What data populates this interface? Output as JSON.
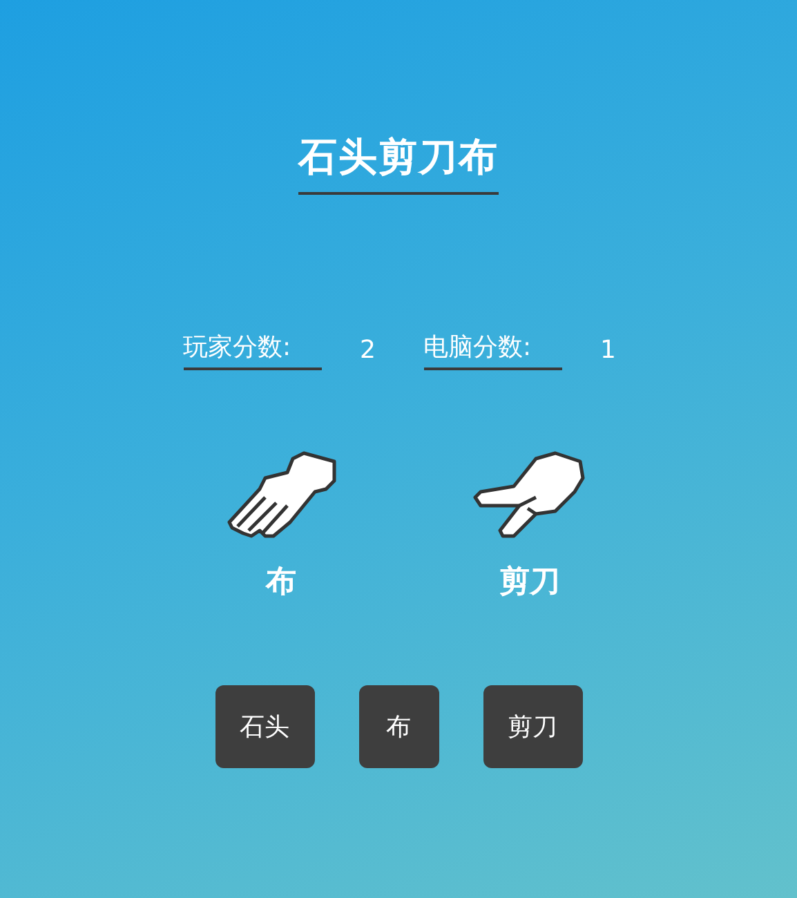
{
  "title": "石头剪刀布",
  "scores": [
    {
      "label": "玩家分数:",
      "value": "2"
    },
    {
      "label": "电脑分数:",
      "value": "1"
    }
  ],
  "choices": [
    {
      "kind": "paper",
      "label": "布"
    },
    {
      "kind": "scissors",
      "label": "剪刀"
    }
  ],
  "buttons": [
    "石头",
    "布",
    "剪刀"
  ]
}
